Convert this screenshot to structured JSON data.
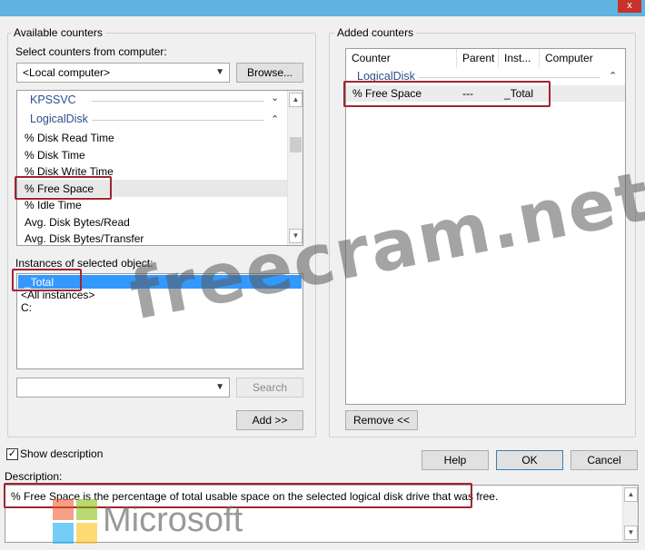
{
  "window": {
    "close_label": "x"
  },
  "available": {
    "group_label": "Available counters",
    "select_label": "Select counters from computer:",
    "computer_value": "<Local computer>",
    "browse_label": "Browse...",
    "counters": {
      "kpssvc": "KPSSVC",
      "logicaldisk": "LogicalDisk",
      "items": [
        "% Disk Read Time",
        "% Disk Time",
        "% Disk Write Time",
        "% Free Space",
        "% Idle Time",
        "Avg. Disk Bytes/Read",
        "Avg. Disk Bytes/Transfer"
      ]
    },
    "instances_label": "Instances of selected object:",
    "instances": [
      "_Total",
      "<All instances>",
      "C:"
    ],
    "search_value": "",
    "search_label": "Search",
    "add_label": "Add >>"
  },
  "added": {
    "group_label": "Added counters",
    "columns": [
      "Counter",
      "Parent",
      "Inst...",
      "Computer"
    ],
    "category": "LogicalDisk",
    "row": {
      "counter": "% Free Space",
      "parent": "---",
      "instance": "_Total",
      "computer": ""
    },
    "remove_label": "Remove <<"
  },
  "options": {
    "show_description_label": "Show description",
    "show_description_checked": true
  },
  "buttons": {
    "help": "Help",
    "ok": "OK",
    "cancel": "Cancel"
  },
  "description": {
    "label": "Description:",
    "text": "% Free Space is the percentage of total usable space on the selected logical disk drive that was free."
  },
  "watermarks": {
    "site": "freecram.net",
    "brand": "Microsoft"
  },
  "colors": {
    "highlight_border": "#a0262e",
    "selection": "#3399ff",
    "category_text": "#2b4f8c",
    "titlebar": "#5fb3df"
  }
}
